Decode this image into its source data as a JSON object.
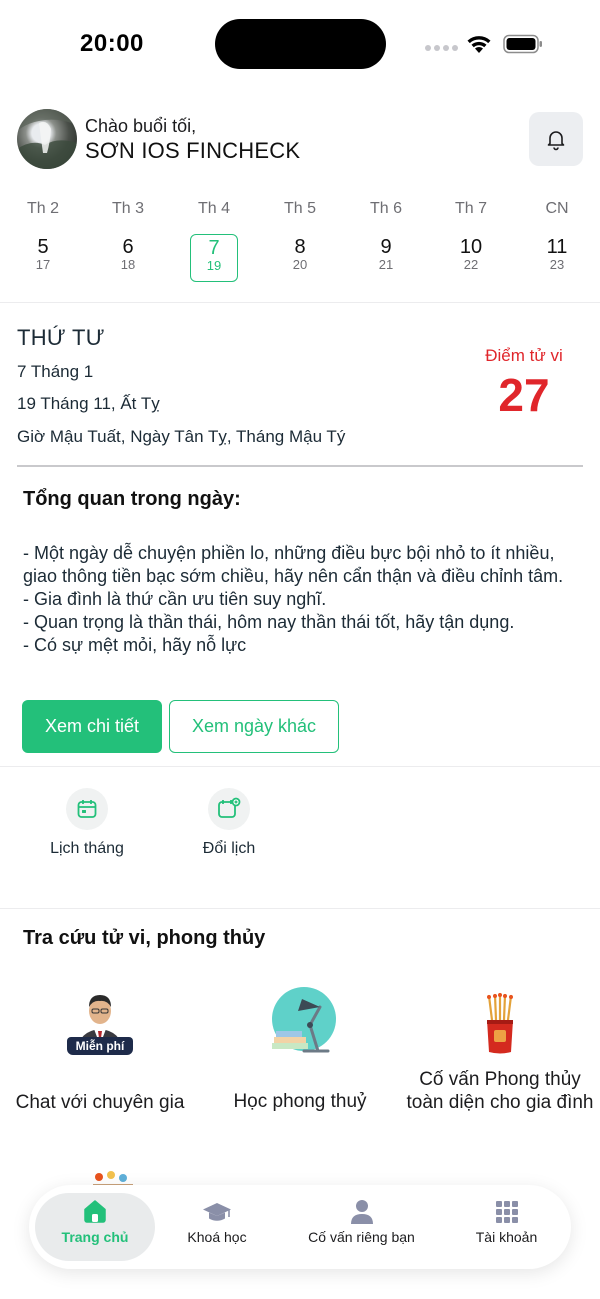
{
  "status_bar": {
    "time": "20:00"
  },
  "header": {
    "greeting": "Chào buổi tối,",
    "user_name": "SƠN IOS FINCHECK"
  },
  "week": [
    {
      "weekday": "Th 2",
      "solar": "5",
      "lunar": "17",
      "selected": false
    },
    {
      "weekday": "Th 3",
      "solar": "6",
      "lunar": "18",
      "selected": false
    },
    {
      "weekday": "Th 4",
      "solar": "7",
      "lunar": "19",
      "selected": true
    },
    {
      "weekday": "Th 5",
      "solar": "8",
      "lunar": "20",
      "selected": false
    },
    {
      "weekday": "Th 6",
      "solar": "9",
      "lunar": "21",
      "selected": false
    },
    {
      "weekday": "Th 7",
      "solar": "10",
      "lunar": "22",
      "selected": false
    },
    {
      "weekday": "CN",
      "solar": "11",
      "lunar": "23",
      "selected": false
    }
  ],
  "day_info": {
    "day_of_week": "THỨ TƯ",
    "solar_date": "7 Tháng 1",
    "lunar_date": "19 Tháng 11, Ất Tỵ",
    "can_chi": "Giờ Mậu Tuất, Ngày Tân Tỵ, Tháng Mậu Tý",
    "score_label": "Điểm tử vi",
    "score": "27"
  },
  "overview": {
    "title": "Tổng quan trong ngày:",
    "lines": [
      "- Một ngày dễ chuyện phiền lo, những điều bực bội nhỏ to ít nhiều, giao thông tiền bạc sớm chiều, hãy nên cẩn thận và điều chỉnh tâm.",
      "- Gia đình là thứ cần ưu tiên suy nghĩ.",
      "- Quan trọng là thần thái, hôm nay thần thái tốt, hãy tận dụng.",
      "- Có sự mệt mỏi, hãy nỗ lực"
    ],
    "detail_button": "Xem chi tiết",
    "other_day_button": "Xem ngày khác"
  },
  "shortcuts": [
    {
      "label": "Lịch tháng",
      "icon": "calendar-icon"
    },
    {
      "label": "Đổi lịch",
      "icon": "calendar-convert-icon"
    }
  ],
  "lookup": {
    "title": "Tra cứu tử vi, phong thủy",
    "free_badge": "Miễn phí",
    "items": [
      {
        "label": "Chat với chuyên gia",
        "icon": "expert-avatar-icon"
      },
      {
        "label": "Học phong thuỷ",
        "icon": "desk-lamp-icon"
      },
      {
        "label": "Cố vấn Phong thủy toàn diện cho gia đình",
        "icon": "incense-icon"
      }
    ]
  },
  "tabbar": [
    {
      "label": "Trang chủ",
      "icon": "home-icon",
      "active": true
    },
    {
      "label": "Khoá học",
      "icon": "graduation-cap-icon",
      "active": false
    },
    {
      "label": "Cố vấn riêng bạn",
      "icon": "person-icon",
      "active": false
    },
    {
      "label": "Tài khoản",
      "icon": "grid-icon",
      "active": false
    }
  ],
  "colors": {
    "accent": "#23c07a",
    "score": "#e0262b"
  }
}
